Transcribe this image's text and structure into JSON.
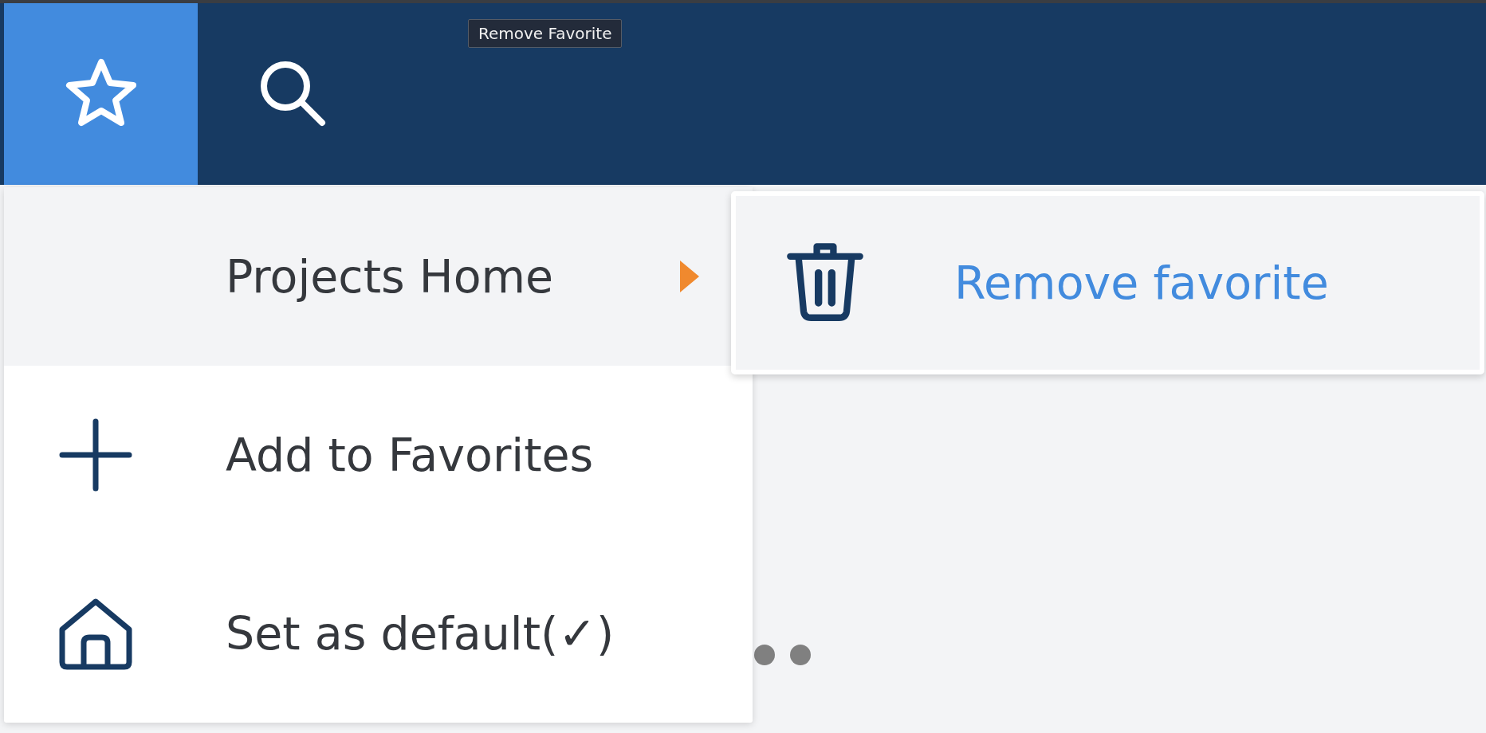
{
  "toolbar": {
    "buttons": [
      {
        "kind": "star",
        "selected": true
      },
      {
        "kind": "search",
        "selected": false
      }
    ]
  },
  "tooltip": "Remove Favorite",
  "menu": {
    "items": [
      {
        "label": "Projects Home",
        "kind": "none",
        "selected": true,
        "has_submenu": true
      },
      {
        "label": "Add to Favorites",
        "kind": "plus",
        "selected": false,
        "has_submenu": false
      },
      {
        "label": "Set as default(✓)",
        "kind": "home",
        "selected": false,
        "has_submenu": false
      }
    ]
  },
  "submenu": {
    "items": [
      {
        "label": "Remove favorite",
        "kind": "trash"
      }
    ]
  }
}
